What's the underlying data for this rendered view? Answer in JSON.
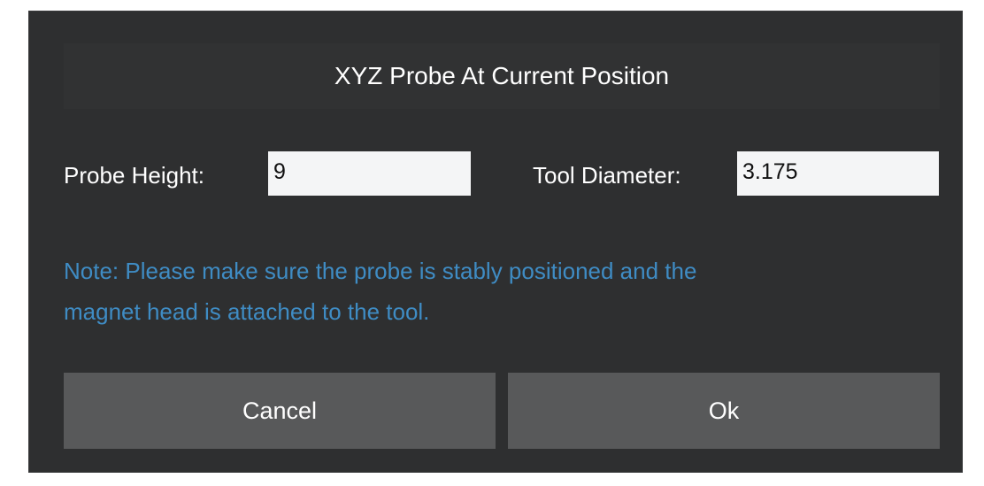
{
  "dialog": {
    "title": "XYZ Probe At Current Position",
    "probe_height": {
      "label": "Probe Height:",
      "value": "9"
    },
    "tool_diameter": {
      "label": "Tool Diameter:",
      "value": "3.175"
    },
    "note_line1": "Note: Please make sure the probe is stably positioned and the",
    "note_line2": "magnet head is attached to the tool.",
    "cancel_label": "Cancel",
    "ok_label": "Ok"
  },
  "colors": {
    "dialog_background": "#2e2f30",
    "button_background": "#58595a",
    "note_text": "#3f8cc4",
    "input_background": "#f4f5f6"
  }
}
